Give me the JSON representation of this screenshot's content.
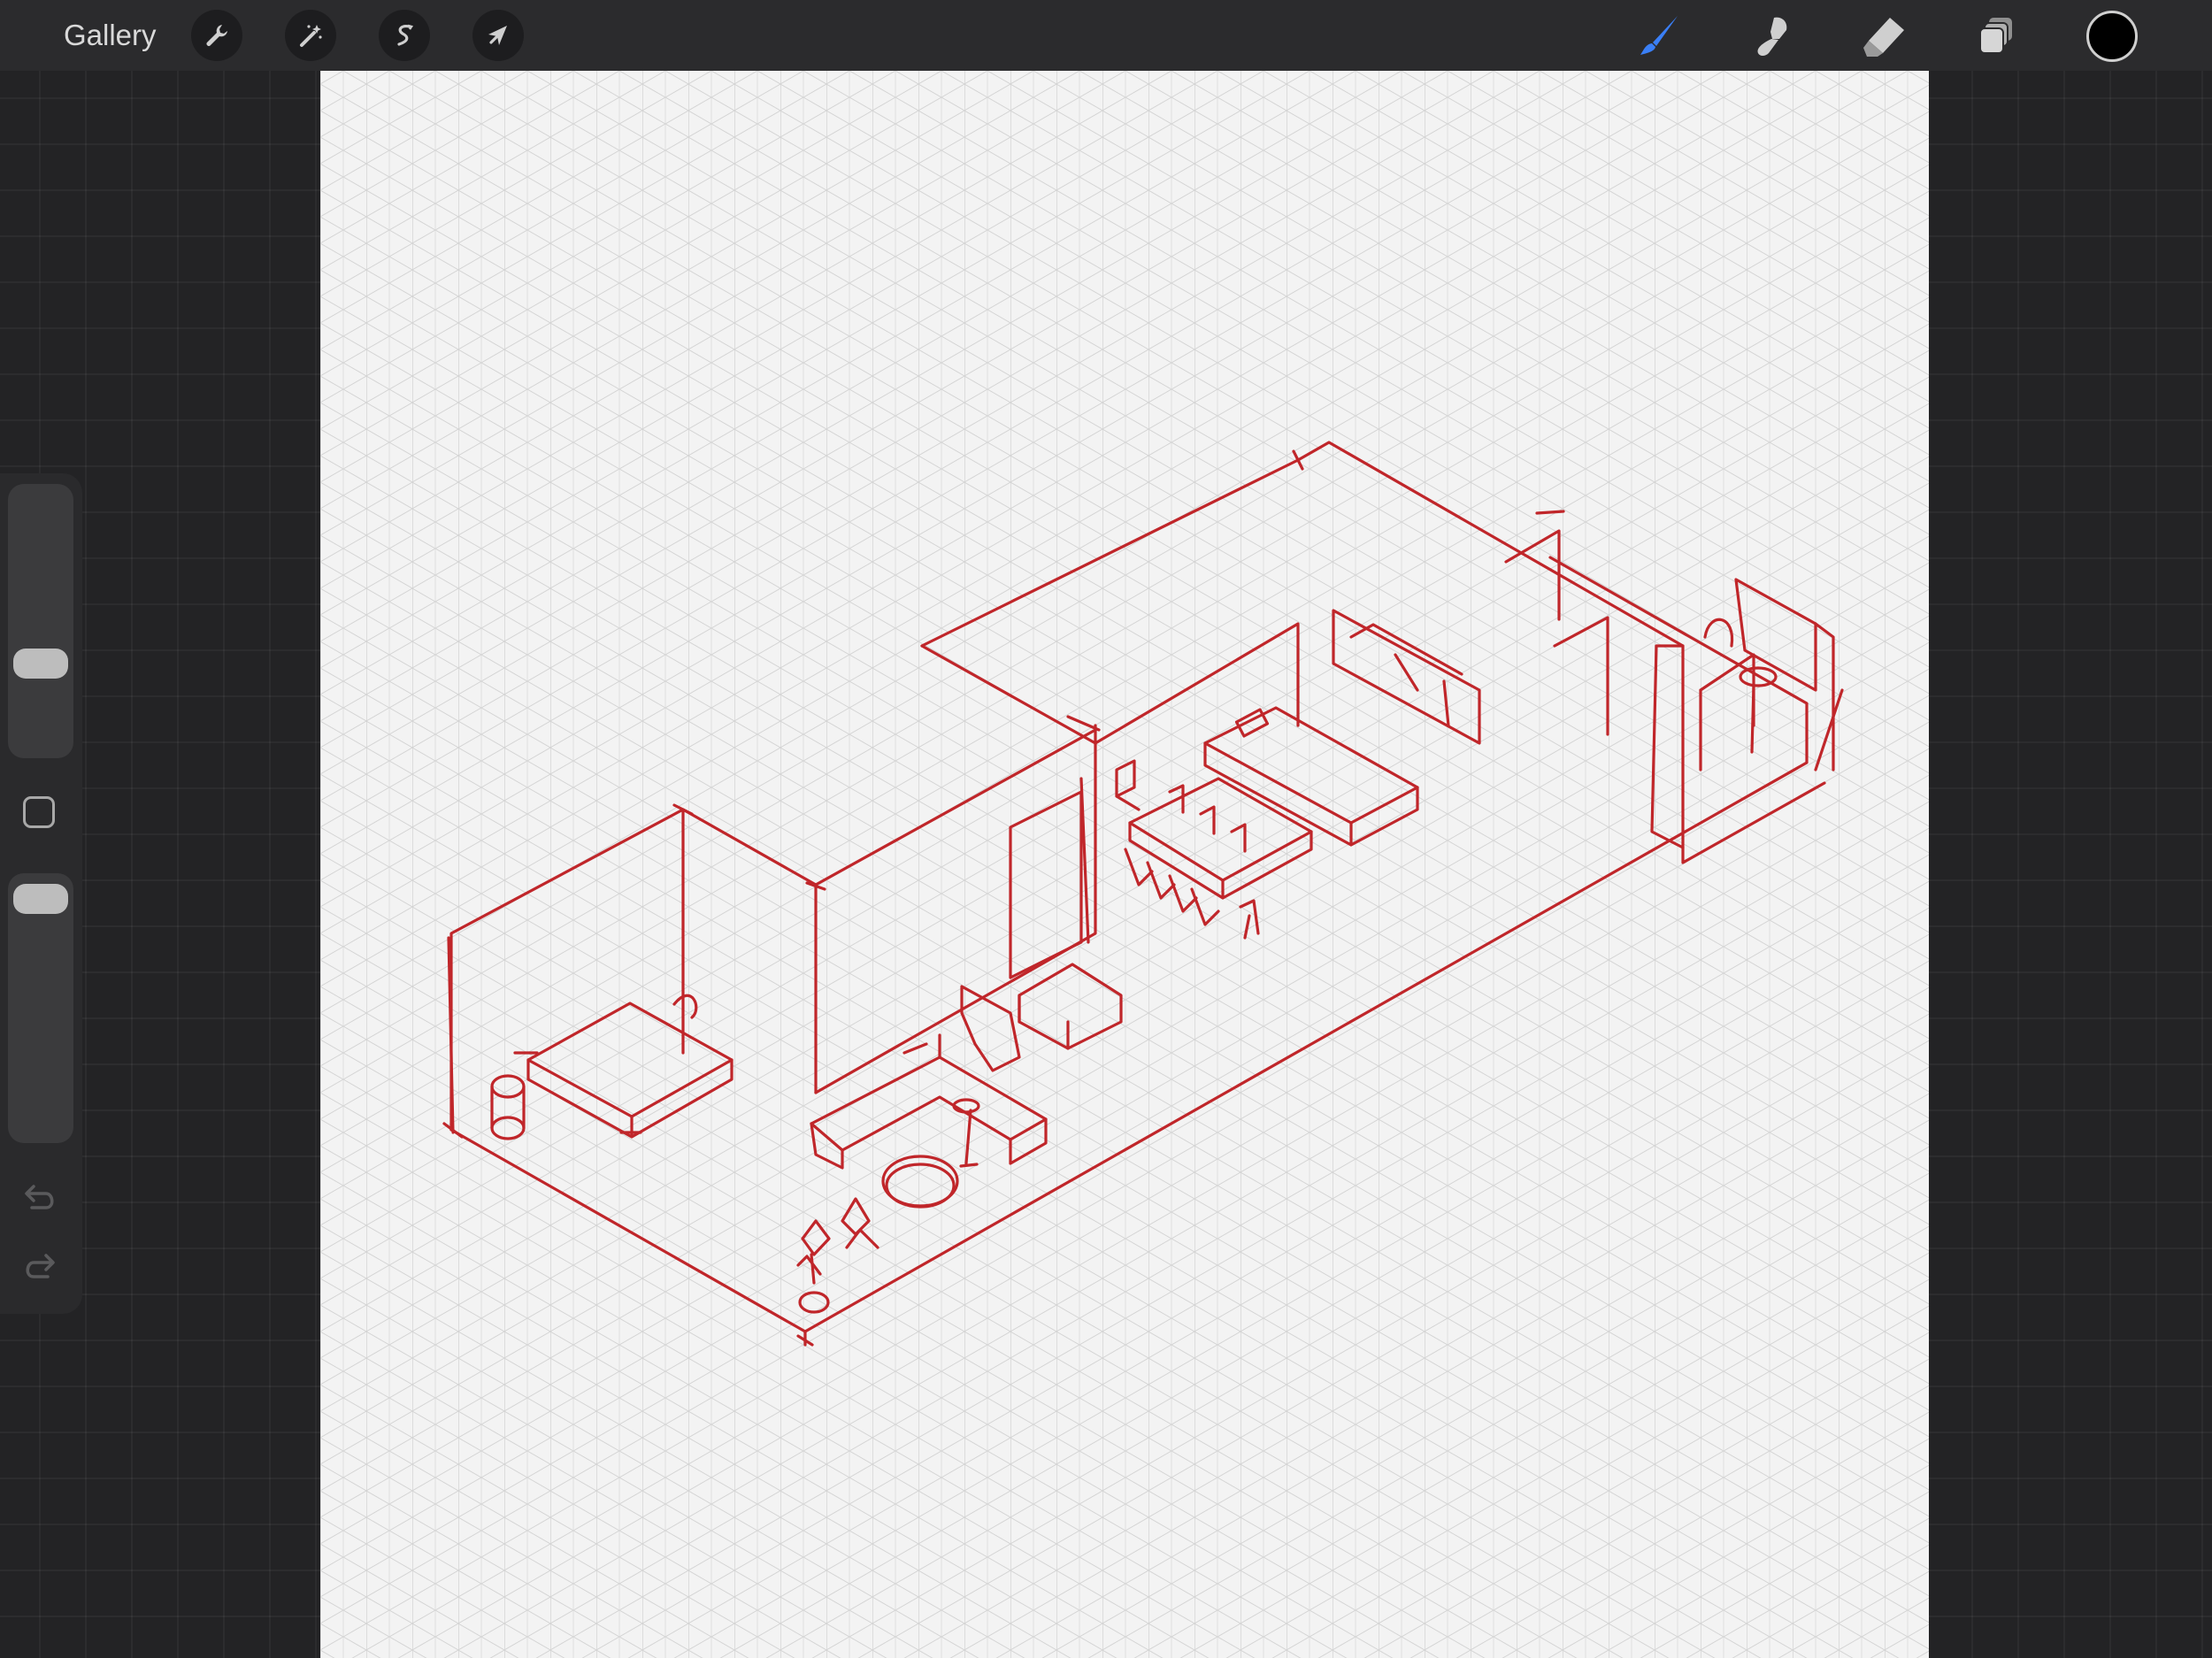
{
  "app": {
    "gallery_label": "Gallery"
  },
  "toolbar": {
    "left_tools": [
      {
        "name": "actions",
        "icon": "wrench-icon"
      },
      {
        "name": "adjustments",
        "icon": "magic-wand-icon"
      },
      {
        "name": "selection",
        "icon": "selection-s-icon"
      },
      {
        "name": "transform",
        "icon": "arrow-cursor-icon"
      }
    ],
    "right_tools": [
      {
        "name": "brush",
        "icon": "brush-icon",
        "active": true
      },
      {
        "name": "smudge",
        "icon": "smudge-icon",
        "active": false
      },
      {
        "name": "eraser",
        "icon": "eraser-icon",
        "active": false
      },
      {
        "name": "layers",
        "icon": "layers-icon",
        "active": false
      }
    ],
    "current_color": "#000000"
  },
  "sidebar": {
    "brush_size_level": 0.38,
    "opacity_level": 0.97,
    "buttons": [
      "square-modify-icon",
      "undo-icon",
      "redo-icon"
    ]
  },
  "colors": {
    "ink": "#c0262a",
    "accent_active": "#3a7ff6",
    "toolbar_bg": "#2b2b2d",
    "canvas_bg": "#f3f3f3"
  }
}
